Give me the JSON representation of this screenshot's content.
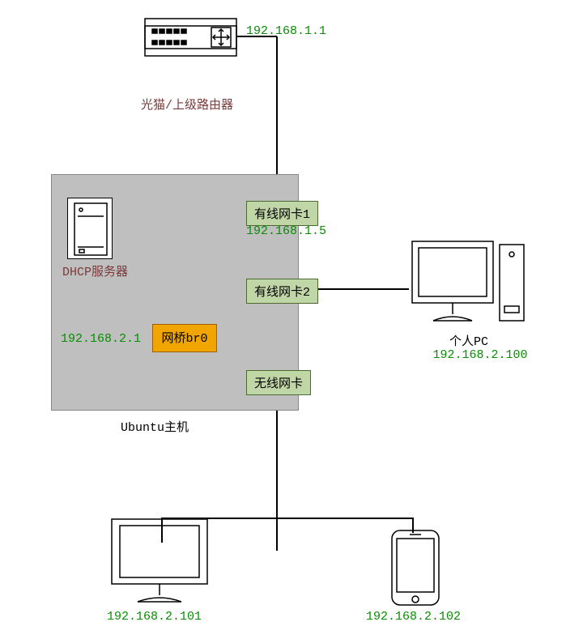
{
  "router": {
    "label": "光猫/上级路由器",
    "ip": "192.168.1.1"
  },
  "ubuntu": {
    "label": "Ubuntu主机",
    "dhcp_label": "DHCP服务器",
    "bridge_label": "网桥br0",
    "bridge_ip": "192.168.2.1",
    "nic1_label": "有线网卡1",
    "nic1_ip": "192.168.1.5",
    "nic2_label": "有线网卡2",
    "nic_wifi_label": "无线网卡"
  },
  "pc_right": {
    "label": "个人PC",
    "ip": "192.168.2.100"
  },
  "pc_bottom": {
    "ip": "192.168.2.101"
  },
  "phone": {
    "ip": "192.168.2.102"
  }
}
